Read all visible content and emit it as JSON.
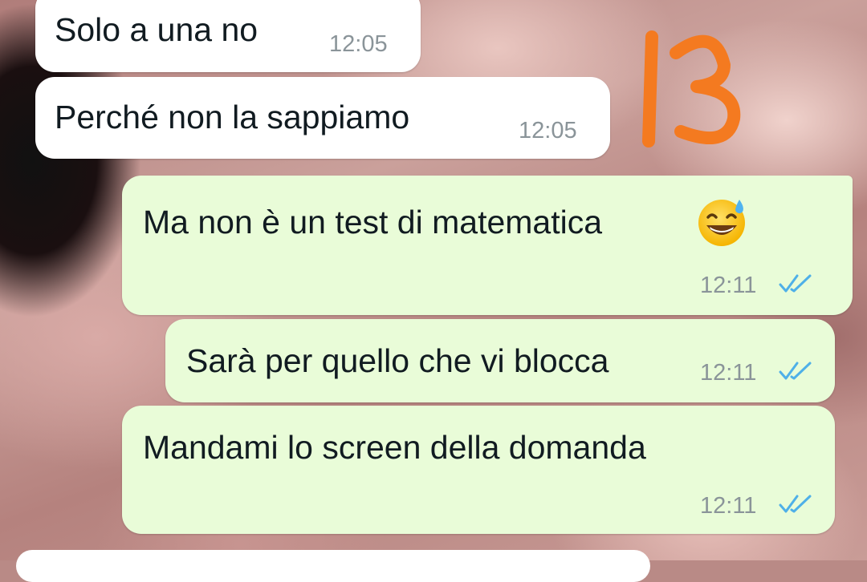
{
  "annotation": {
    "text": "13",
    "color": "#f47a20"
  },
  "colors": {
    "incoming_bubble": "#ffffff",
    "outgoing_bubble": "#e9fcd8",
    "read_ticks": "#4fb0e8",
    "timestamp": "#8a9499"
  },
  "messages": [
    {
      "direction": "incoming",
      "text": "Solo a una no",
      "time": "12:05"
    },
    {
      "direction": "incoming",
      "text": "Perché non la sappiamo",
      "time": "12:05"
    },
    {
      "direction": "outgoing",
      "text": "Ma non è un test di matematica",
      "emoji": "grinning-face-with-sweat",
      "time": "12:11",
      "status": "read"
    },
    {
      "direction": "outgoing",
      "text": "Sarà per quello che vi blocca",
      "time": "12:11",
      "status": "read"
    },
    {
      "direction": "outgoing",
      "text": "Mandami lo screen della domanda",
      "time": "12:11",
      "status": "read"
    }
  ]
}
